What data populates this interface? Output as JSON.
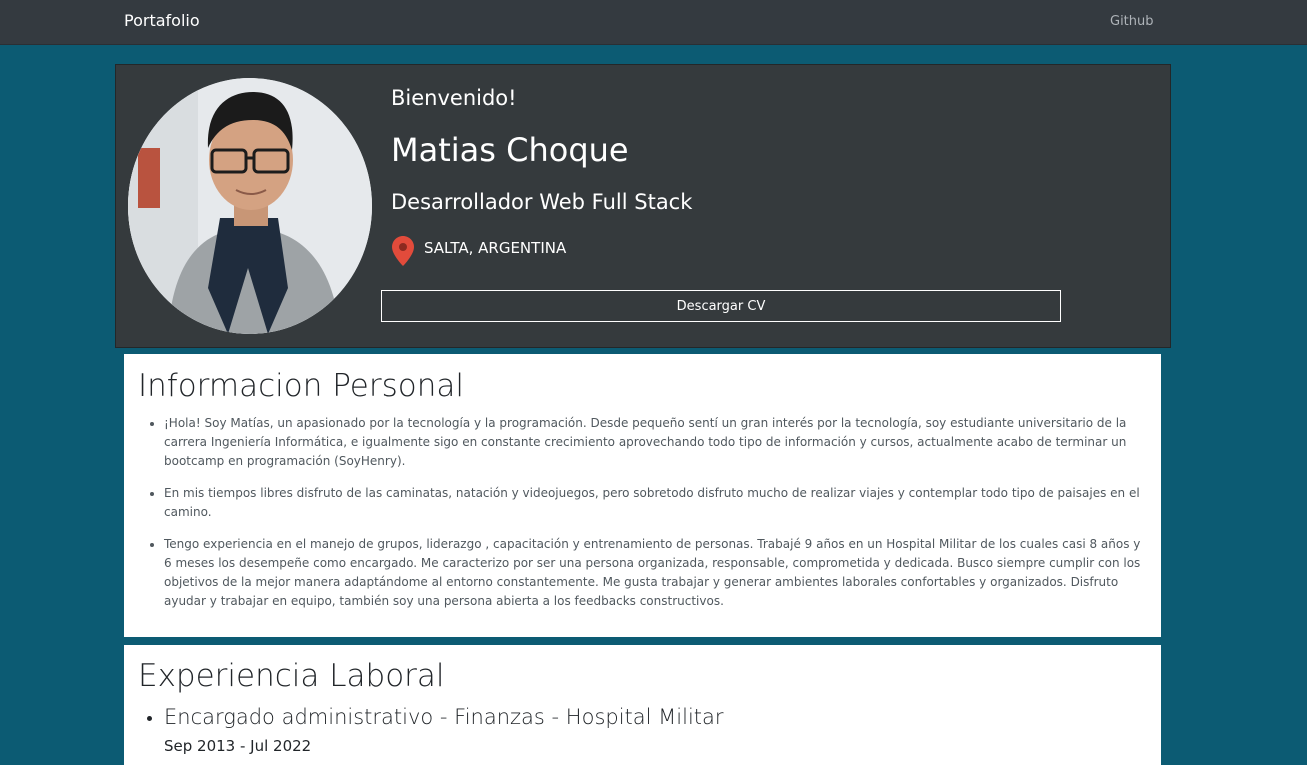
{
  "nav": {
    "brand": "Portafolio",
    "links": [
      {
        "label": "Github"
      }
    ]
  },
  "hero": {
    "welcome": "Bienvenido!",
    "name": "Matias Choque",
    "role": "Desarrollador Web Full Stack",
    "location": "SALTA, ARGENTINA",
    "cv_button": "Descargar CV",
    "pin_color": "#e24b3b"
  },
  "info": {
    "title": "Informacion Personal",
    "items": [
      "¡Hola! Soy Matías, un apasionado por la tecnología y la programación. Desde pequeño sentí un gran interés por la tecnología, soy estudiante universitario de la carrera Ingeniería Informática, e igualmente sigo en constante crecimiento aprovechando todo tipo de información y cursos, actualmente acabo de terminar un bootcamp en programación (SoyHenry).",
      "En mis tiempos libres disfruto de las caminatas, natación y videojuegos, pero sobretodo disfruto mucho de realizar viajes y contemplar todo tipo de paisajes en el camino.",
      "Tengo experiencia en el manejo de grupos, liderazgo , capacitación y entrenamiento de personas. Trabajé 9 años en un Hospital Militar de los cuales casi 8 años y 6 meses los desempeñe como encargado. Me caracterizo por ser una persona organizada, responsable, comprometida y dedicada. Busco siempre cumplir con los objetivos de la mejor manera adaptándome al entorno constantemente. Me gusta trabajar y generar ambientes laborales confortables y organizados. Disfruto ayudar y trabajar en equipo, también soy una persona abierta a los feedbacks constructivos."
    ]
  },
  "experience": {
    "title": "Experiencia Laboral",
    "jobs": [
      {
        "title": "Encargado administrativo - Finanzas - Hospital Militar",
        "dates": "Sep 2013 - Jul 2022"
      }
    ]
  },
  "colors": {
    "page_bg": "#0c5b73",
    "navbar_bg": "#343a40",
    "hero_bg": "#353a3d"
  }
}
